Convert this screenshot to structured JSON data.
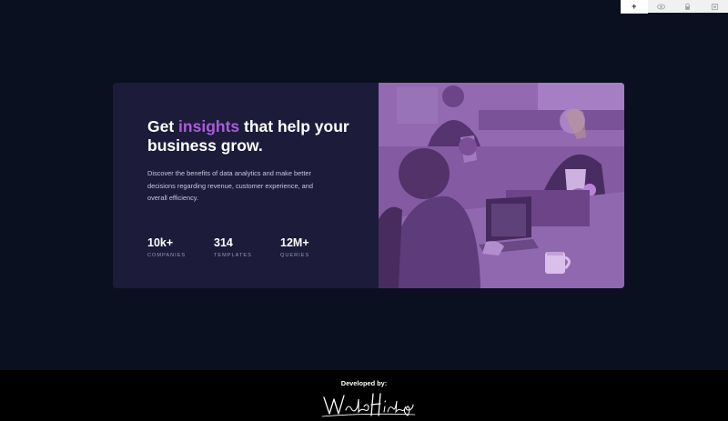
{
  "toolbar": {
    "buttons": [
      {
        "icon": "plus-icon",
        "label": "+"
      },
      {
        "icon": "eye-icon"
      },
      {
        "icon": "lock-icon"
      },
      {
        "icon": "window-icon"
      }
    ]
  },
  "card": {
    "headline": {
      "before": "Get ",
      "accent": "insights",
      "after": " that help your business grow."
    },
    "description": "Discover the benefits of data analytics and make better decisions regarding revenue, customer experience, and overall efficiency.",
    "stats": [
      {
        "value": "10k+",
        "label": "COMPANIES"
      },
      {
        "value": "314",
        "label": "TEMPLATES"
      },
      {
        "value": "12M+",
        "label": "QUERIES"
      }
    ],
    "image_tint": "#aa5cdb"
  },
  "footer": {
    "label": "Developed by:",
    "signature": "Waldo Hidalgo"
  },
  "colors": {
    "background": "#0b1020",
    "card": "#1c1b3a",
    "accent": "#aa5cdb",
    "footer": "#000000"
  }
}
